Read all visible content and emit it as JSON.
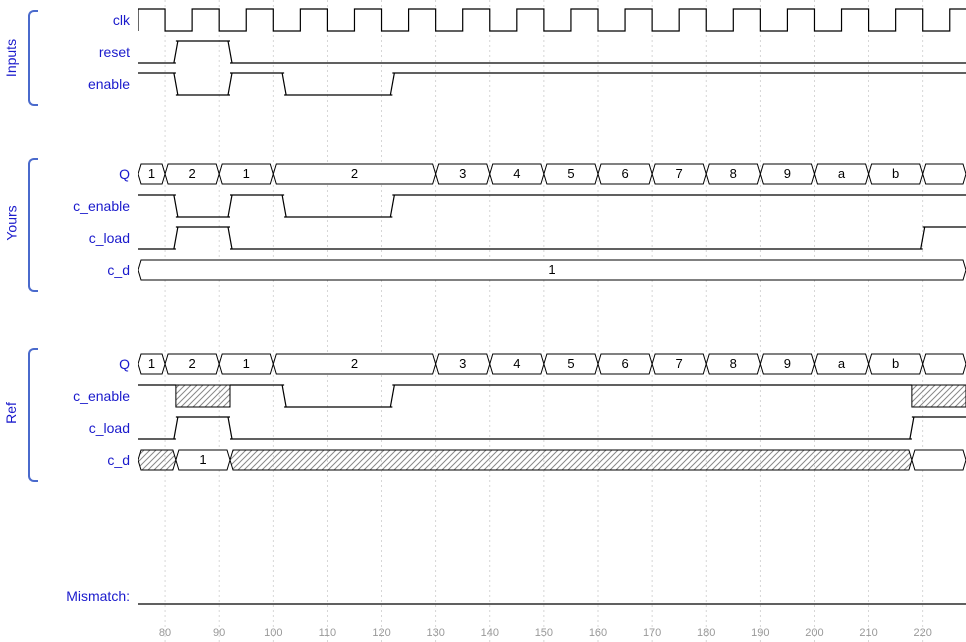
{
  "groups": {
    "inputs": "Inputs",
    "yours": "Yours",
    "ref": "Ref"
  },
  "signals": {
    "clk": "clk",
    "reset": "reset",
    "enable": "enable",
    "Q": "Q",
    "c_enable": "c_enable",
    "c_load": "c_load",
    "c_d": "c_d",
    "mismatch": "Mismatch:"
  },
  "axis": {
    "ticks": [
      "80",
      "90",
      "100",
      "110",
      "120",
      "130",
      "140",
      "150",
      "160",
      "170",
      "180",
      "190",
      "200",
      "210",
      "220"
    ]
  },
  "chart_data": {
    "type": "timing_diagram",
    "time_range": [
      75,
      228
    ],
    "clock_period": 10,
    "groups": [
      {
        "name": "Inputs",
        "signals": [
          {
            "name": "clk",
            "type": "clock",
            "period": 10,
            "start": 75
          },
          {
            "name": "reset",
            "type": "binary",
            "segments": [
              [
                75,
                82,
                0
              ],
              [
                82,
                92,
                1
              ],
              [
                92,
                228,
                0
              ]
            ]
          },
          {
            "name": "enable",
            "type": "binary",
            "segments": [
              [
                75,
                82,
                1
              ],
              [
                82,
                92,
                0
              ],
              [
                92,
                102,
                1
              ],
              [
                102,
                122,
                0
              ],
              [
                122,
                228,
                1
              ]
            ]
          }
        ]
      },
      {
        "name": "Yours",
        "signals": [
          {
            "name": "Q",
            "type": "bus",
            "segments": [
              [
                75,
                80,
                "1"
              ],
              [
                80,
                90,
                "2"
              ],
              [
                90,
                100,
                "1"
              ],
              [
                100,
                130,
                "2"
              ],
              [
                130,
                140,
                "3"
              ],
              [
                140,
                150,
                "4"
              ],
              [
                150,
                160,
                "5"
              ],
              [
                160,
                170,
                "6"
              ],
              [
                170,
                180,
                "7"
              ],
              [
                180,
                190,
                "8"
              ],
              [
                190,
                200,
                "9"
              ],
              [
                200,
                210,
                "a"
              ],
              [
                210,
                220,
                "b"
              ],
              [
                220,
                228,
                ""
              ]
            ]
          },
          {
            "name": "c_enable",
            "type": "binary",
            "segments": [
              [
                75,
                82,
                1
              ],
              [
                82,
                92,
                0
              ],
              [
                92,
                102,
                1
              ],
              [
                102,
                122,
                0
              ],
              [
                122,
                228,
                1
              ]
            ]
          },
          {
            "name": "c_load",
            "type": "binary",
            "segments": [
              [
                75,
                82,
                0
              ],
              [
                82,
                92,
                1
              ],
              [
                92,
                220,
                0
              ],
              [
                220,
                228,
                1
              ]
            ]
          },
          {
            "name": "c_d",
            "type": "bus",
            "segments": [
              [
                75,
                228,
                "1"
              ]
            ]
          }
        ]
      },
      {
        "name": "Ref",
        "signals": [
          {
            "name": "Q",
            "type": "bus",
            "segments": [
              [
                75,
                80,
                "1"
              ],
              [
                80,
                90,
                "2"
              ],
              [
                90,
                100,
                "1"
              ],
              [
                100,
                130,
                "2"
              ],
              [
                130,
                140,
                "3"
              ],
              [
                140,
                150,
                "4"
              ],
              [
                150,
                160,
                "5"
              ],
              [
                160,
                170,
                "6"
              ],
              [
                170,
                180,
                "7"
              ],
              [
                180,
                190,
                "8"
              ],
              [
                190,
                200,
                "9"
              ],
              [
                200,
                210,
                "a"
              ],
              [
                210,
                220,
                "b"
              ],
              [
                220,
                228,
                ""
              ]
            ]
          },
          {
            "name": "c_enable",
            "type": "binary_dontcare",
            "segments": [
              [
                75,
                82,
                1
              ],
              [
                82,
                92,
                "x"
              ],
              [
                92,
                102,
                1
              ],
              [
                102,
                122,
                0
              ],
              [
                122,
                218,
                1
              ],
              [
                218,
                228,
                "x"
              ]
            ]
          },
          {
            "name": "c_load",
            "type": "binary",
            "segments": [
              [
                75,
                82,
                0
              ],
              [
                82,
                92,
                1
              ],
              [
                92,
                218,
                0
              ],
              [
                218,
                228,
                1
              ]
            ]
          },
          {
            "name": "c_d",
            "type": "bus_dontcare",
            "segments": [
              [
                75,
                82,
                "x"
              ],
              [
                82,
                92,
                "1"
              ],
              [
                92,
                218,
                "x"
              ],
              [
                218,
                228,
                ""
              ]
            ]
          }
        ]
      }
    ],
    "mismatch": {
      "segments": [
        [
          75,
          228,
          0
        ]
      ]
    }
  }
}
